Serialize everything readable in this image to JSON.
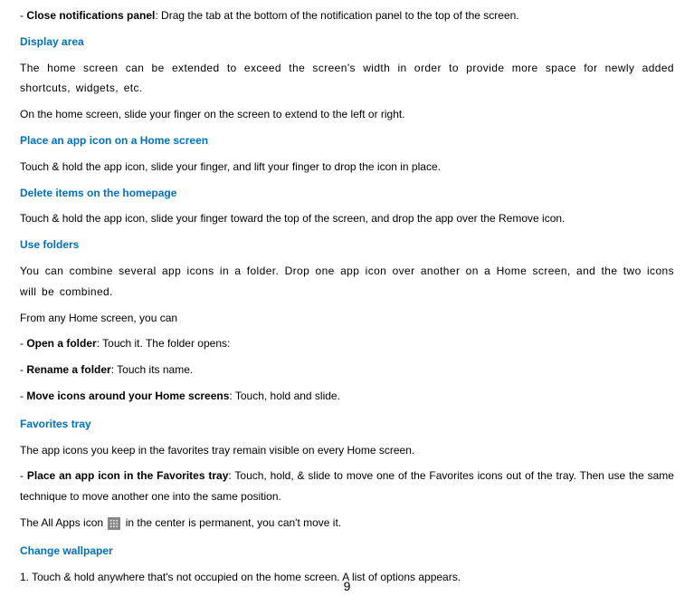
{
  "close_notifications_bold": "Close notifications panel",
  "close_notifications_rest": ": Drag the tab at the bottom of the notification panel to the top of the screen.",
  "display_area_heading": "Display area",
  "display_area_p1": "The home screen can be extended to exceed the screen's width in order to provide more space for newly added shortcuts, widgets, etc.",
  "display_area_p2": "On the home screen, slide your finger on the screen to extend to the left or right.",
  "place_icon_heading": "Place an app icon on a Home screen",
  "place_icon_p1": "Touch & hold the app icon, slide your finger, and lift your finger to drop the icon in place.",
  "delete_items_heading": "Delete items on the homepage",
  "delete_items_p1": "Touch & hold the app icon, slide your finger toward the top of the screen, and drop the app over the Remove icon.",
  "use_folders_heading": "Use folders",
  "use_folders_p1": "You can combine several app icons in a folder. Drop one app icon over another on a Home screen, and the two icons will be combined.",
  "use_folders_p2": "From any Home screen, you can",
  "open_folder_bold": "Open a folder",
  "open_folder_rest": ": Touch it. The folder opens:",
  "rename_folder_bold": "Rename a folder",
  "rename_folder_rest": ": Touch its name.",
  "move_icons_bold": "Move icons around your Home screens",
  "move_icons_rest": ": Touch, hold and slide.",
  "favorites_heading": "Favorites tray",
  "favorites_p1": "The app icons you keep in the favorites tray remain visible on every Home screen.",
  "favorites_place_bold": "Place an app icon in the Favorites tray",
  "favorites_place_rest": ": Touch, hold, & slide to move one of the Favorites icons out of the tray. Then use the same technique to move another one into the same position.",
  "favorites_allapps_before": "The All Apps icon ",
  "favorites_allapps_after": " in the center is permanent, you can't move it.",
  "change_wallpaper_heading": "Change wallpaper",
  "change_wallpaper_p1": "1. Touch & hold anywhere that's not occupied on the home screen. A list of options appears.",
  "page_number": "9"
}
